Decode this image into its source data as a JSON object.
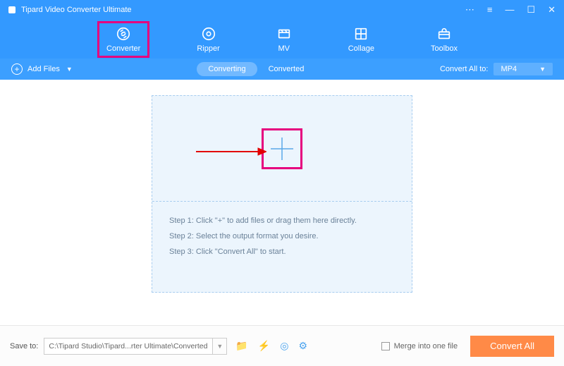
{
  "app": {
    "title": "Tipard Video Converter Ultimate"
  },
  "nav": {
    "items": [
      {
        "label": "Converter",
        "icon": "converter"
      },
      {
        "label": "Ripper",
        "icon": "ripper"
      },
      {
        "label": "MV",
        "icon": "mv"
      },
      {
        "label": "Collage",
        "icon": "collage"
      },
      {
        "label": "Toolbox",
        "icon": "toolbox"
      }
    ]
  },
  "toolbar": {
    "add_files": "Add Files",
    "seg_converting": "Converting",
    "seg_converted": "Converted",
    "convert_all_to": "Convert All to:",
    "format": "MP4"
  },
  "dropzone": {
    "steps": [
      "Step 1: Click \"+\" to add files or drag them here directly.",
      "Step 2: Select the output format you desire.",
      "Step 3: Click \"Convert All\" to start."
    ]
  },
  "footer": {
    "save_to": "Save to:",
    "path": "C:\\Tipard Studio\\Tipard...rter Ultimate\\Converted",
    "merge": "Merge into one file",
    "convert_all": "Convert All"
  }
}
